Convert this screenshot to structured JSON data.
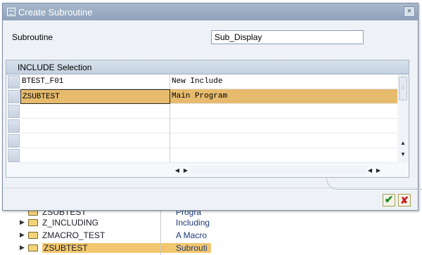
{
  "dialog": {
    "title": "Create Subroutine",
    "close_glyph": "×",
    "field": {
      "label": "Subroutine",
      "value": "Sub_Display"
    },
    "include_group": {
      "title": "INCLUDE Selection",
      "rows": [
        {
          "program": "BTEST_F01",
          "description": "New Include",
          "selected": false
        },
        {
          "program": "ZSUBTEST",
          "description": "Main Program",
          "selected": true
        },
        {
          "program": "",
          "description": "",
          "selected": false
        },
        {
          "program": "",
          "description": "",
          "selected": false
        },
        {
          "program": "",
          "description": "",
          "selected": false
        },
        {
          "program": "",
          "description": "",
          "selected": false
        }
      ]
    },
    "ok_glyph": "✔",
    "cancel_glyph": "✘"
  },
  "background_tree": {
    "rows": [
      {
        "name": "ZSUBTEST",
        "description": "Progra",
        "has_arrow": false,
        "selected": false
      },
      {
        "name": "Z_INCLUDING",
        "description": "Including",
        "has_arrow": true,
        "selected": false
      },
      {
        "name": "ZMACRO_TEST",
        "description": "A Macro",
        "has_arrow": true,
        "selected": false
      },
      {
        "name": "ZSUBTEST",
        "description": "Subrouti",
        "has_arrow": true,
        "selected": true
      }
    ]
  },
  "colors": {
    "selection": "#e6bb6e",
    "titlebar": "#94a7bd",
    "ok": "#1f8a1f",
    "cancel": "#c62020"
  },
  "icons": [
    "dialog-title-icon",
    "close-icon",
    "folder-icon",
    "expand-arrow-icon",
    "scroll-up-icon",
    "scroll-down-icon",
    "scroll-left-icon",
    "scroll-right-icon",
    "checkmark-icon",
    "cancel-x-icon"
  ]
}
